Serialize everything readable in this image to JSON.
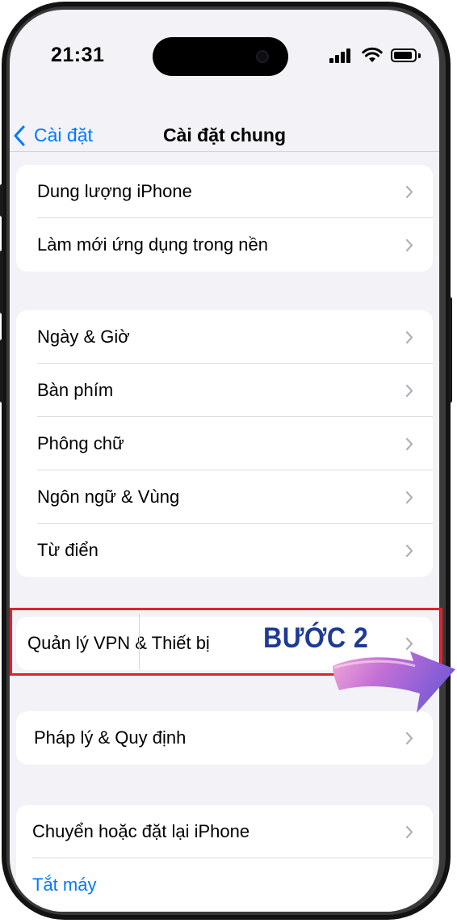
{
  "status_bar": {
    "time": "21:31"
  },
  "nav": {
    "back_label": "Cài đặt",
    "title": "Cài đặt chung"
  },
  "groups": [
    {
      "items": [
        {
          "label": "Dung lượng iPhone"
        },
        {
          "label": "Làm mới ứng dụng trong nền"
        }
      ]
    },
    {
      "items": [
        {
          "label": "Ngày & Giờ"
        },
        {
          "label": "Bàn phím"
        },
        {
          "label": "Phông chữ"
        },
        {
          "label": "Ngôn ngữ & Vùng"
        },
        {
          "label": "Từ điển"
        }
      ]
    },
    {
      "items": [
        {
          "label": "Quản lý VPN & Thiết bị"
        }
      ]
    },
    {
      "items": [
        {
          "label": "Pháp lý & Quy định"
        }
      ]
    },
    {
      "items": [
        {
          "label": "Chuyển hoặc đặt lại iPhone"
        }
      ],
      "footer_link": "Tắt máy"
    }
  ],
  "annotation": {
    "step_label": "BƯỚC 2",
    "highlight_color": "#e0212f",
    "step_color": "#1f3a96"
  },
  "colors": {
    "accent": "#007aff",
    "background": "#f2f2f7"
  },
  "icons": {
    "back": "chevron-left-icon",
    "row": "chevron-right-icon"
  }
}
